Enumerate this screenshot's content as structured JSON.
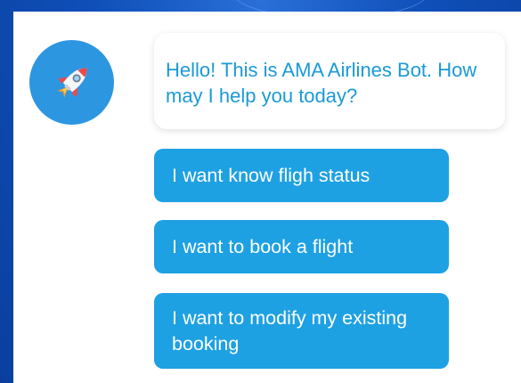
{
  "bot": {
    "avatar_icon": "rocket-icon",
    "message": "Hello! This is AMA Airlines Bot. How may I help you today?"
  },
  "options": [
    {
      "label": "I want know fligh status"
    },
    {
      "label": "I want to book a flight"
    },
    {
      "label": "I want to modify my existing booking"
    }
  ],
  "colors": {
    "background": "#0f4fb8",
    "panel": "#ffffff",
    "bot_text": "#1a9ad6",
    "button": "#1ea1e3",
    "button_text": "#ffffff",
    "avatar_bg": "#2d96e0"
  }
}
